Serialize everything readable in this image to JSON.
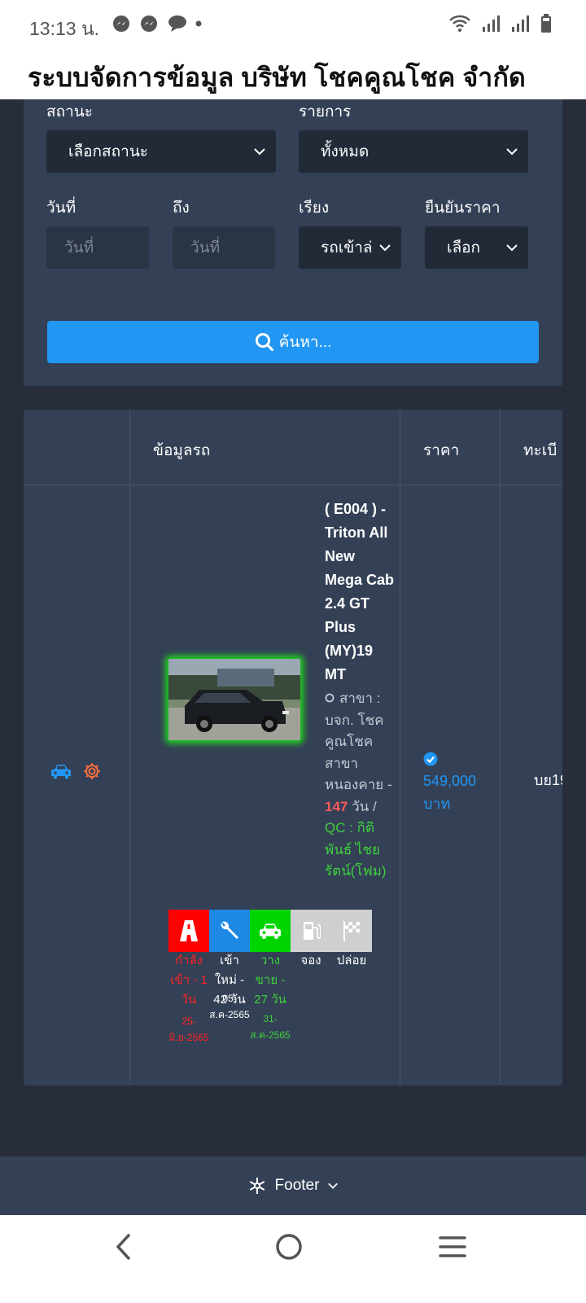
{
  "status_bar": {
    "time": "13:13 น.",
    "icons": [
      "messenger-icon",
      "messenger-icon",
      "chat-bubble-icon",
      "dot-icon",
      "wifi-icon",
      "signal-icon",
      "signal-icon",
      "battery-icon"
    ]
  },
  "header": {
    "title": "ระบบจัดการข้อมูล บริษัท โชคคูณโชค จำกัด"
  },
  "filters": {
    "status_label": "สถานะ",
    "status_value": "เลือกสถานะ",
    "list_label": "รายการ",
    "list_value": "ทั้งหมด",
    "date_label": "วันที่",
    "date_placeholder": "วันที่",
    "to_label": "ถึง",
    "to_placeholder": "วันที่",
    "sort_label": "เรียง",
    "sort_value": "รถเข้าล่",
    "confirm_label": "ยืนยันราคา",
    "confirm_value": "เลือก",
    "search_label": "ค้นหา..."
  },
  "table": {
    "headers": [
      "",
      "ข้อมูลรถ",
      "ราคา",
      "ทะเบี"
    ],
    "row": {
      "title": "( E004 ) - Triton All New Mega Cab 2.4 GT Plus (MY)19 MT",
      "branch_prefix": "สาขา : บจก. โชคคูณโชค สาขาหนองคาย - ",
      "days": "147",
      "days_unit": " วัน / ",
      "qc_text": "QC : กิติพันธ์ ไชยรัตน์(โฟม)",
      "price_line1": "549,000",
      "price_line2": "บาท",
      "registration": "บย19",
      "stages": [
        {
          "label": "กำลังเข้า - 1 วัน",
          "date": "25-มิ.ย-2565",
          "color": "#ff2222"
        },
        {
          "label": "เข้าใหม่ - 42 วัน",
          "date": "05-ส.ค-2565",
          "color": "#ffffff"
        },
        {
          "label": "วางขาย - 27 วัน",
          "date": "31-ส.ค-2565",
          "color": "#3ed13e"
        },
        {
          "label": "จอง",
          "date": "",
          "color": "#ffffff"
        },
        {
          "label": "ปล่อย",
          "date": "",
          "color": "#ffffff"
        }
      ]
    }
  },
  "footer": {
    "label": "Footer"
  },
  "nav": {
    "icons": [
      "back-icon",
      "home-icon",
      "menu-icon"
    ]
  }
}
